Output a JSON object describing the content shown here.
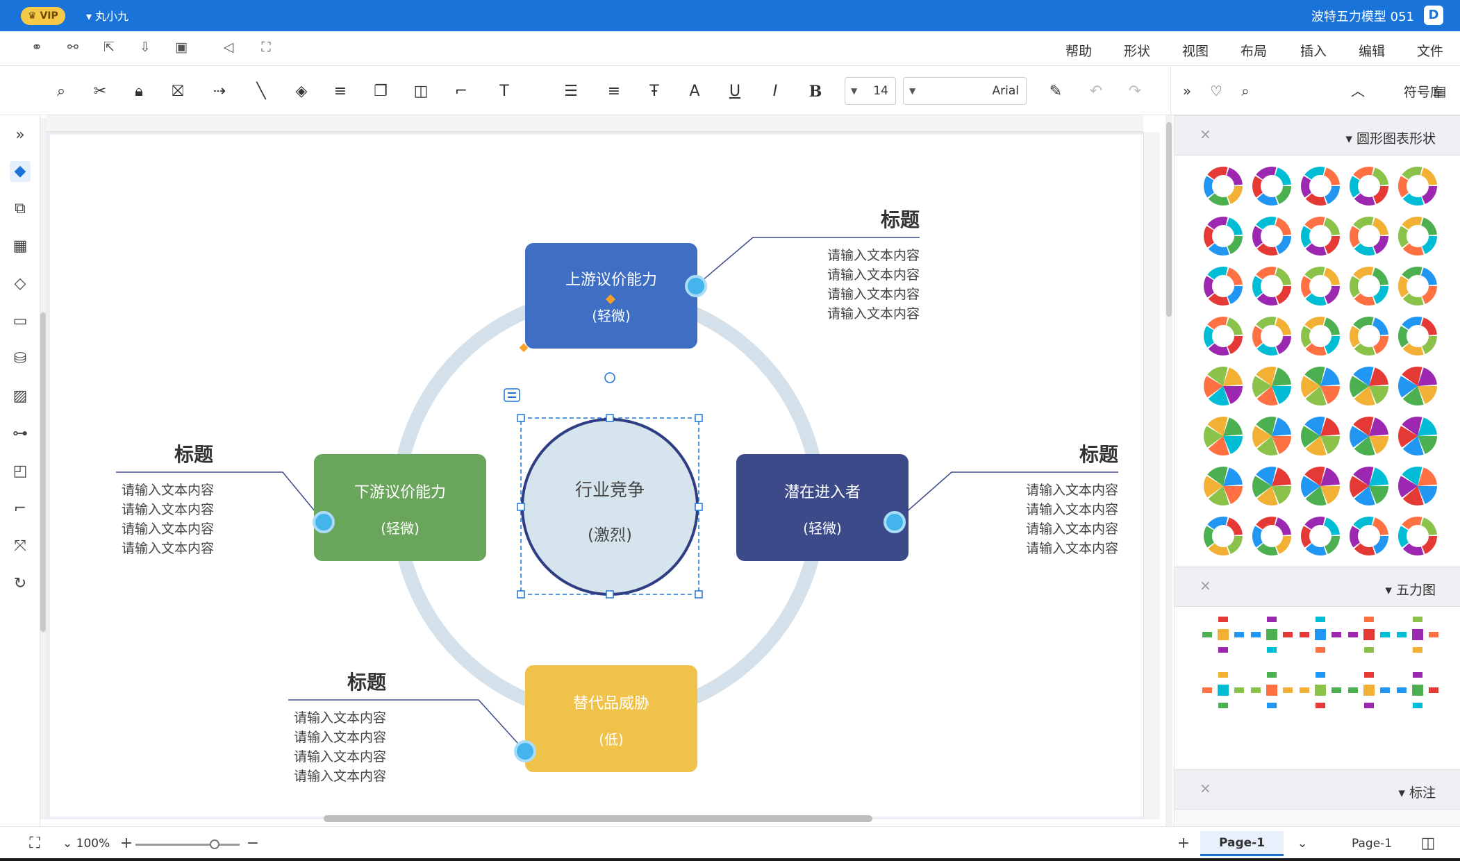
{
  "titlebar": {
    "app_icon": "file-doc-icon",
    "title": "波特五力模型 051",
    "vip_label": "VIP",
    "user_name": "丸小九"
  },
  "menu": {
    "items": [
      "文件",
      "编辑",
      "插入",
      "布局",
      "视图",
      "形状",
      "帮助"
    ],
    "quick_icons": [
      "share-icon",
      "present-icon",
      "save-icon",
      "download-icon",
      "export-icon",
      "connect-icon",
      "group-icon"
    ]
  },
  "toolbar": {
    "font_name": "Arial",
    "font_size": "14",
    "bold_label": "B",
    "italic_label": "I",
    "underline_label": "U",
    "text_color_label": "A",
    "text_tool_label": "T"
  },
  "right_top": {
    "label": "符号库"
  },
  "leftbar": {
    "icons": [
      "expand-icon",
      "format-icon",
      "page-icon",
      "grid-icon",
      "layers-icon",
      "presentation-icon",
      "data-icon",
      "image-icon",
      "org-icon",
      "layout-icon",
      "connector-icon",
      "mindmap-icon",
      "history-icon"
    ]
  },
  "diagram": {
    "center": {
      "title": "行业竞争",
      "level": "(激烈)"
    },
    "top": {
      "title": "上游议价能力",
      "level": "(轻微)"
    },
    "left": {
      "title": "下游议价能力",
      "level": "(轻微)"
    },
    "right": {
      "title": "潜在进入者",
      "level": "(轻微)"
    },
    "bottom": {
      "title": "替代品威胁",
      "level": "(低)"
    },
    "callouts": {
      "heading": "标题",
      "line": "请输入文本内容"
    },
    "colors": {
      "top": "#3e6fc4",
      "left": "#6aa55c",
      "right": "#3d4a8a",
      "bottom": "#f0c24a",
      "ring": "#d4e1ea",
      "center_fill": "#d6e4ee",
      "center_stroke": "#2f3d83",
      "dot": "#43b4ec"
    }
  },
  "rpanel": {
    "sections": [
      {
        "label": "圆形图表形状",
        "close": "×"
      },
      {
        "label": "五力图",
        "close": "×"
      },
      {
        "label": "标注",
        "close": "×"
      }
    ]
  },
  "bottombar": {
    "page_tab_inactive": "Page-1",
    "page_tab_active": "Page-1",
    "zoom_label": "100%",
    "add_page": "+"
  }
}
